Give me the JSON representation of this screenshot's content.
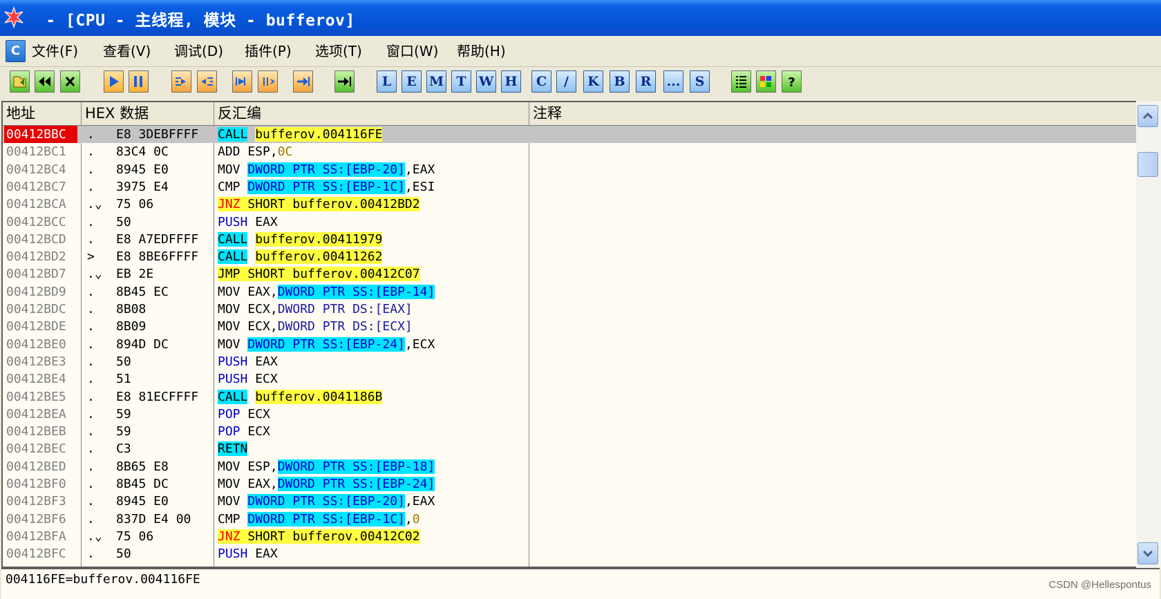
{
  "window": {
    "title": " - [CPU - 主线程, 模块 - bufferov]"
  },
  "menu": {
    "c_button": "C",
    "items": [
      "文件(F)",
      "查看(V)",
      "调试(D)",
      "插件(P)",
      "选项(T)",
      "窗口(W)",
      "帮助(H)"
    ]
  },
  "toolbar": {
    "buttons": [
      "open",
      "rewind",
      "close",
      "run",
      "pause",
      "step-into",
      "step-over",
      "trace-into",
      "trace-over",
      "execute-till-return",
      "go-to"
    ],
    "letters": [
      "L",
      "E",
      "M",
      "T",
      "W",
      "H",
      "C",
      "/",
      "K",
      "B",
      "R",
      "...",
      "S"
    ]
  },
  "columns": {
    "address": "地址",
    "hex": "HEX 数据",
    "disasm": "反汇编",
    "comment": "注释"
  },
  "rows": [
    {
      "addr": "00412BBC",
      "flag": ".",
      "hex": "E8 3DEBFFFF",
      "op": "CALL",
      "args": "bufferov.004116FE",
      "style": "call",
      "sel": true
    },
    {
      "addr": "00412BC1",
      "flag": ".",
      "hex": "83C4 0C",
      "op": "ADD",
      "args": "ESP,0C",
      "style": "plain-olive"
    },
    {
      "addr": "00412BC4",
      "flag": ".",
      "hex": "8945 E0",
      "op": "MOV",
      "args": "DWORD PTR SS:[EBP-20],EAX",
      "style": "mov-ptr-first"
    },
    {
      "addr": "00412BC7",
      "flag": ".",
      "hex": "3975 E4",
      "op": "CMP",
      "args": "DWORD PTR SS:[EBP-1C],ESI",
      "style": "mov-ptr-first"
    },
    {
      "addr": "00412BCA",
      "flag": ".v",
      "hex": "75 06",
      "op": "JNZ",
      "args": "SHORT bufferov.00412BD2",
      "style": "jnz"
    },
    {
      "addr": "00412BCC",
      "flag": ".",
      "hex": "50",
      "op": "PUSH",
      "args": "EAX",
      "style": "push"
    },
    {
      "addr": "00412BCD",
      "flag": ".",
      "hex": "E8 A7EDFFFF",
      "op": "CALL",
      "args": "bufferov.00411979",
      "style": "call"
    },
    {
      "addr": "00412BD2",
      "flag": ">",
      "hex": "E8 8BE6FFFF",
      "op": "CALL",
      "args": "bufferov.00411262",
      "style": "call"
    },
    {
      "addr": "00412BD7",
      "flag": ".v",
      "hex": "EB 2E",
      "op": "JMP",
      "args": "SHORT bufferov.00412C07",
      "style": "jmp"
    },
    {
      "addr": "00412BD9",
      "flag": ".",
      "hex": "8B45 EC",
      "op": "MOV",
      "args": "EAX,DWORD PTR SS:[EBP-14]",
      "style": "mov-ptr-second"
    },
    {
      "addr": "00412BDC",
      "flag": ".",
      "hex": "8B08",
      "op": "MOV",
      "args": "ECX,DWORD PTR DS:[EAX]",
      "style": "mov-ds"
    },
    {
      "addr": "00412BDE",
      "flag": ".",
      "hex": "8B09",
      "op": "MOV",
      "args": "ECX,DWORD PTR DS:[ECX]",
      "style": "mov-ds"
    },
    {
      "addr": "00412BE0",
      "flag": ".",
      "hex": "894D DC",
      "op": "MOV",
      "args": "DWORD PTR SS:[EBP-24],ECX",
      "style": "mov-ptr-first"
    },
    {
      "addr": "00412BE3",
      "flag": ".",
      "hex": "50",
      "op": "PUSH",
      "args": "EAX",
      "style": "push"
    },
    {
      "addr": "00412BE4",
      "flag": ".",
      "hex": "51",
      "op": "PUSH",
      "args": "ECX",
      "style": "push"
    },
    {
      "addr": "00412BE5",
      "flag": ".",
      "hex": "E8 81ECFFFF",
      "op": "CALL",
      "args": "bufferov.0041186B",
      "style": "call"
    },
    {
      "addr": "00412BEA",
      "flag": ".",
      "hex": "59",
      "op": "POP",
      "args": "ECX",
      "style": "push"
    },
    {
      "addr": "00412BEB",
      "flag": ".",
      "hex": "59",
      "op": "POP",
      "args": "ECX",
      "style": "push"
    },
    {
      "addr": "00412BEC",
      "flag": ".",
      "hex": "C3",
      "op": "RETN",
      "args": "",
      "style": "retn"
    },
    {
      "addr": "00412BED",
      "flag": ".",
      "hex": "8B65 E8",
      "op": "MOV",
      "args": "ESP,DWORD PTR SS:[EBP-18]",
      "style": "mov-ptr-second"
    },
    {
      "addr": "00412BF0",
      "flag": ".",
      "hex": "8B45 DC",
      "op": "MOV",
      "args": "EAX,DWORD PTR SS:[EBP-24]",
      "style": "mov-ptr-second"
    },
    {
      "addr": "00412BF3",
      "flag": ".",
      "hex": "8945 E0",
      "op": "MOV",
      "args": "DWORD PTR SS:[EBP-20],EAX",
      "style": "mov-ptr-first"
    },
    {
      "addr": "00412BF6",
      "flag": ".",
      "hex": "837D E4 00",
      "op": "CMP",
      "args": "DWORD PTR SS:[EBP-1C],0",
      "style": "cmp-zero"
    },
    {
      "addr": "00412BFA",
      "flag": ".v",
      "hex": "75 06",
      "op": "JNZ",
      "args": "SHORT bufferov.00412C02",
      "style": "jnz"
    },
    {
      "addr": "00412BFC",
      "flag": ".",
      "hex": "50",
      "op": "PUSH",
      "args": "EAX",
      "style": "push"
    }
  ],
  "status": {
    "text": "004116FE=bufferov.004116FE"
  },
  "watermark": "CSDN @Hellespontus",
  "colors": {
    "selected_address": "#e60000",
    "cyan_highlight": "#00e5ff",
    "yellow_highlight": "#ffff40"
  }
}
